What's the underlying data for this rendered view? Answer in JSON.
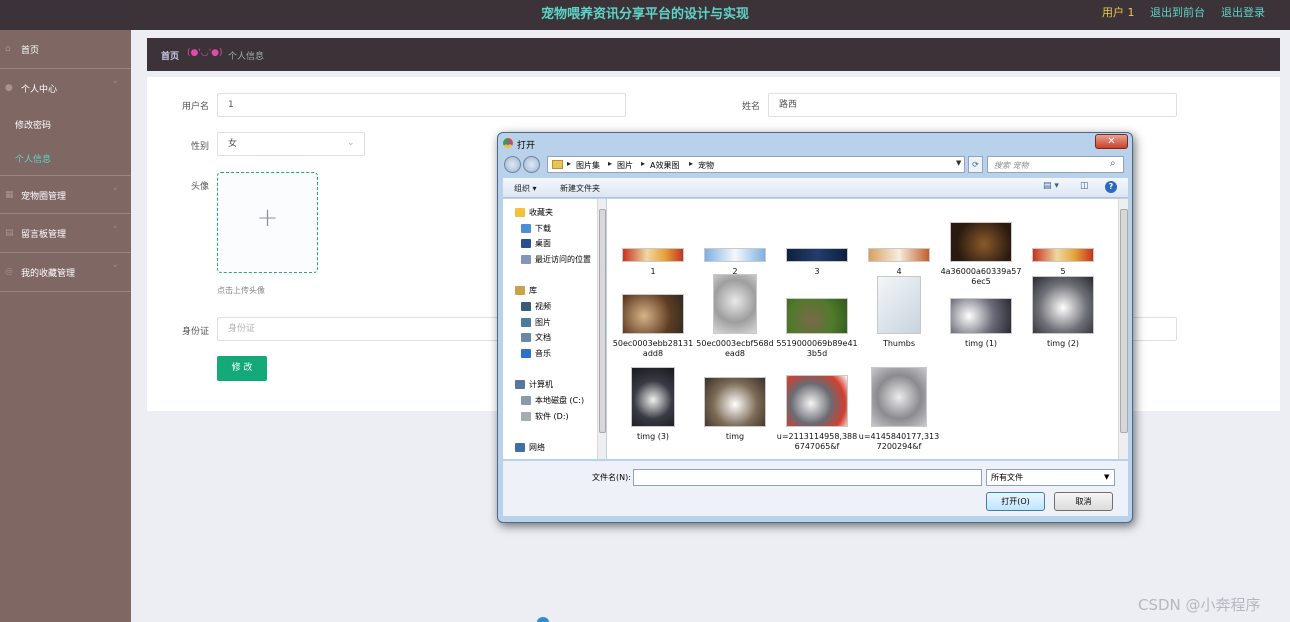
{
  "header": {
    "title": "宠物喂养资讯分享平台的设计与实现",
    "user": "用户 1",
    "front_link": "退出到前台",
    "logout_link": "退出登录"
  },
  "sidebar": {
    "home": "首页",
    "personal_center": "个人中心",
    "change_password": "修改密码",
    "personal_info": "个人信息",
    "pet_circle": "宠物圈管理",
    "message_board": "留言板管理",
    "my_favorites": "我的收藏管理"
  },
  "breadcrumb": {
    "home": "首页",
    "emoticon": "(●'◡'●)",
    "current": "个人信息"
  },
  "form": {
    "username_label": "用户名",
    "username_value": "1",
    "name_label": "姓名",
    "name_value": "路西",
    "gender_label": "性别",
    "gender_value": "女",
    "avatar_label": "头像",
    "upload_tip": "点击上传头像",
    "idcard_label": "身份证",
    "idcard_placeholder": "身份证",
    "submit": "修 改"
  },
  "dialog": {
    "title": "打开",
    "path": [
      "图片集",
      "图片",
      "A效果图",
      "宠物"
    ],
    "search_placeholder": "搜索 宠物",
    "toolbar": {
      "organize": "组织 ▾",
      "new_folder": "新建文件夹"
    },
    "nav": {
      "favorites": "收藏夹",
      "downloads": "下载",
      "desktop": "桌面",
      "recent": "最近访问的位置",
      "libraries": "库",
      "videos": "视频",
      "pictures": "图片",
      "documents": "文档",
      "music": "音乐",
      "computer": "计算机",
      "drive_c": "本地磁盘 (C:)",
      "drive_d": "软件 (D:)",
      "network": "网络"
    },
    "files": [
      {
        "name": "1",
        "kind": "banner-red"
      },
      {
        "name": "2",
        "kind": "banner-blue"
      },
      {
        "name": "3",
        "kind": "banner-dark"
      },
      {
        "name": "4",
        "kind": "banner-warm"
      },
      {
        "name": "4a36000a60339a576ec5",
        "kind": "cat-dark"
      },
      {
        "name": "5",
        "kind": "banner-red"
      },
      {
        "name": "50ec0003ebb28131add8",
        "kind": "cats"
      },
      {
        "name": "50ec0003ecbf568dead8",
        "kind": "kitten"
      },
      {
        "name": "5519000069b89e413b5d",
        "kind": "cat-grass"
      },
      {
        "name": "Thumbs",
        "kind": "system"
      },
      {
        "name": "timg (1)",
        "kind": "huskies"
      },
      {
        "name": "timg (2)",
        "kind": "husky"
      },
      {
        "name": "timg (3)",
        "kind": "husky-dark"
      },
      {
        "name": "timg",
        "kind": "husky-bright"
      },
      {
        "name": "u=2113114958,3886747065&f",
        "kind": "husky-rose"
      },
      {
        "name": "u=4145840177,3137200294&f",
        "kind": "husky-pup"
      }
    ],
    "filename_label": "文件名(N):",
    "filetype": "所有文件",
    "open_button": "打开(O)",
    "cancel_button": "取消"
  },
  "watermark": "CSDN @小奔程序"
}
